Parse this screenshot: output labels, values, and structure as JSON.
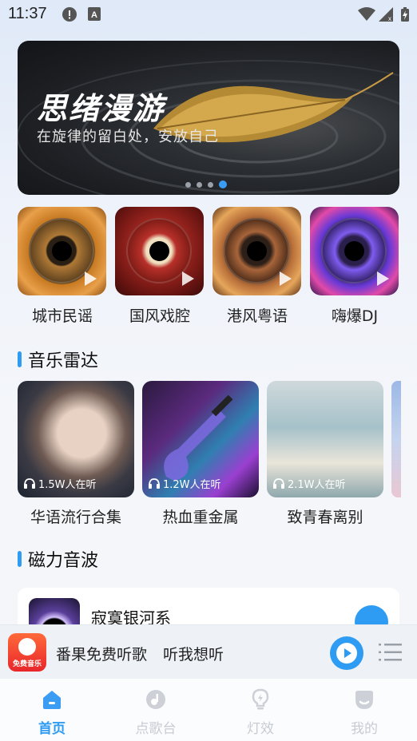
{
  "status_bar": {
    "time": "11:37"
  },
  "banner": {
    "title": "思绪漫游",
    "subtitle": "在旋律的留白处，安放自己",
    "dots": 4,
    "active_dot": 3
  },
  "categories": [
    {
      "label": "城市民谣",
      "icon": "folk-guitar-disc"
    },
    {
      "label": "国风戏腔",
      "icon": "opera-disc"
    },
    {
      "label": "港风粤语",
      "icon": "cantonese-disc"
    },
    {
      "label": "嗨爆DJ",
      "icon": "dj-disc"
    }
  ],
  "radar": {
    "title": "音乐雷达",
    "playlists": [
      {
        "label": "华语流行合集",
        "listeners": "1.5W人在听"
      },
      {
        "label": "热血重金属",
        "listeners": "1.2W人在听"
      },
      {
        "label": "致青春离别",
        "listeners": "2.1W人在听"
      }
    ]
  },
  "waves": {
    "title": "磁力音波",
    "songs": [
      {
        "title": "寂寞银河系"
      }
    ]
  },
  "mini_player": {
    "logo_text": "免费音乐",
    "title": "番果免费听歌 听我想听"
  },
  "nav": {
    "items": [
      {
        "label": "首页",
        "icon": "home-icon",
        "active": true
      },
      {
        "label": "点歌台",
        "icon": "music-note-icon",
        "active": false
      },
      {
        "label": "灯效",
        "icon": "lightbulb-icon",
        "active": false
      },
      {
        "label": "我的",
        "icon": "profile-icon",
        "active": false
      }
    ]
  },
  "colors": {
    "accent": "#2f9bf2",
    "inactive": "#c7cbd2"
  }
}
